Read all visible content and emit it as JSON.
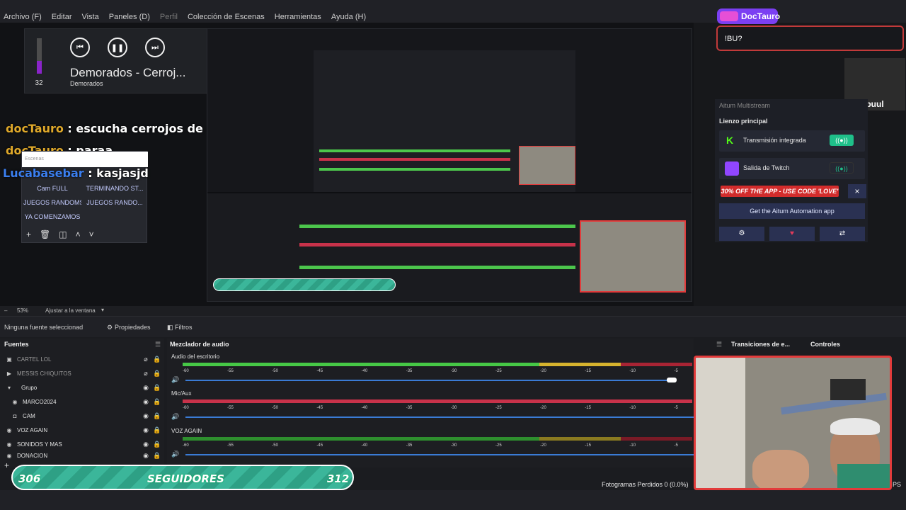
{
  "menubar": [
    "Archivo (F)",
    "Editar",
    "Vista",
    "Paneles (D)",
    "Perfil",
    "Colección de Escenas",
    "Herramientas",
    "Ayuda (H)"
  ],
  "media": {
    "volume": "32",
    "title": "Demorados - Cerroj...",
    "artist": "Demorados",
    "prev_icon": "prev-icon",
    "pause_icon": "pause-icon",
    "next_icon": "next-icon"
  },
  "chat": [
    {
      "user": "docTauro",
      "text": " : escucha cerrojos de demorados"
    },
    {
      "user": "docTauro",
      "text": " : paraa"
    },
    {
      "user": "Lucabasebar",
      "text": " : kasjasjd"
    }
  ],
  "scenes": {
    "header": "Escenas",
    "items": [
      "Cam FULL",
      "TERMINANDO ST...",
      "JUEGOS RANDOMS",
      "JUEGOS RANDO...",
      "YA COMENZAMOS"
    ]
  },
  "alert": {
    "user": "DocTauro",
    "message": "!BU?"
  },
  "kabuul": "Kabuul",
  "aitum": {
    "title": "Aitum Multistream",
    "section": "Lienzo principal",
    "rows": [
      {
        "label": "Transmisión integrada",
        "toggle": "((●))"
      },
      {
        "label": "Salida de Twitch",
        "toggle": "((●))"
      }
    ],
    "promo": "30% OFF THE APP - USE CODE 'LOVE'",
    "close": "×",
    "get_app": "Get the Aitum Automation app",
    "buttons": [
      "⚙",
      "♥",
      "⇄"
    ],
    "colors": {
      "accent_green": "#1fc08a",
      "promo_red": "#d22c2c",
      "button_blue": "#2a3152"
    }
  },
  "zoom": {
    "level": "53%",
    "fit": "Ajustar a la ventana"
  },
  "propbar": {
    "no_source": "Ninguna fuente seleccionad",
    "properties": "Propiedades",
    "filters": "Filtros"
  },
  "sources": {
    "title": "Fuentes",
    "items": [
      {
        "name": "CARTEL LOL",
        "icon": "▣"
      },
      {
        "name": "MESSIS CHIQUITOS",
        "icon": "▶"
      },
      {
        "name": "Grupo",
        "icon": "▾"
      },
      {
        "name": "MARCO2024",
        "icon": "◉"
      },
      {
        "name": "CAM",
        "icon": "◘"
      },
      {
        "name": "VOZ AGAIN",
        "icon": "◉"
      },
      {
        "name": "SONIDOS Y MAS",
        "icon": "◉"
      },
      {
        "name": "DONACION",
        "icon": "◉"
      }
    ]
  },
  "mixer": {
    "title": "Mezclador de audio",
    "transitions": "Transiciones de e...",
    "controls": "Controles",
    "scale": [
      "-60",
      "-55",
      "-50",
      "-45",
      "-40",
      "-35",
      "-30",
      "-25",
      "-20",
      "-15",
      "-10",
      "-5"
    ],
    "tracks": [
      {
        "name": "Audio del escritorio"
      },
      {
        "name": "Mic/Aux"
      },
      {
        "name": "VOZ AGAIN"
      }
    ]
  },
  "followers": {
    "current": "306",
    "label": "SEGUIDORES",
    "goal": "312"
  },
  "status": {
    "dropped": "Fotogramas Perdidos 0 (0.0%)",
    "fps": "PS"
  }
}
